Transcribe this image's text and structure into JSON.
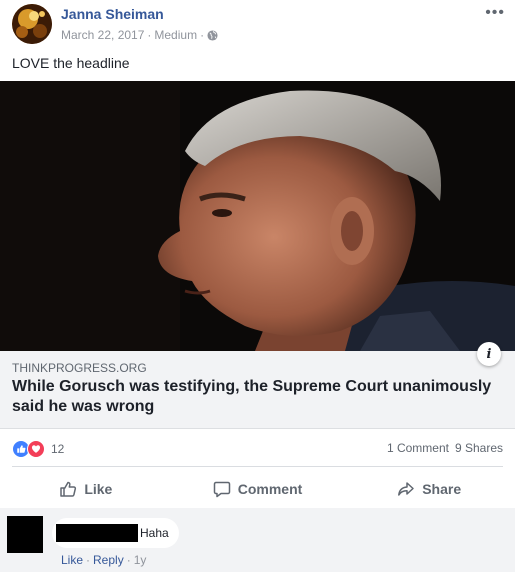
{
  "post": {
    "author": "Janna Sheiman",
    "date": "March 22, 2017",
    "source_app": "Medium",
    "text": "LOVE the headline",
    "more": "•••"
  },
  "link": {
    "domain": "THINKPROGRESS.ORG",
    "headline": "While Gorusch was testifying, the Supreme Court unanimously said he was wrong",
    "info_icon": "i"
  },
  "stats": {
    "reaction_count": "12",
    "comments": "1 Comment",
    "shares": "9 Shares"
  },
  "actions": {
    "like": "Like",
    "comment": "Comment",
    "share": "Share"
  },
  "comment": {
    "text": "Haha",
    "like": "Like",
    "reply": "Reply",
    "age": "1y"
  },
  "colors": {
    "link_blue": "#365899",
    "like_blue": "#4080ff",
    "love_red": "#f33e58",
    "meta_gray": "#90949c"
  }
}
